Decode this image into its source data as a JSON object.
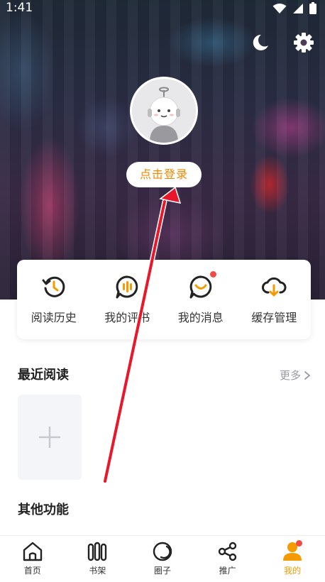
{
  "status_bar": {
    "time": "1:41"
  },
  "header": {
    "icons": [
      "moon-icon",
      "gear-icon"
    ]
  },
  "profile": {
    "login_label": "点击登录"
  },
  "quick_actions": [
    {
      "label": "阅读历史",
      "icon": "history-icon"
    },
    {
      "label": "我的评书",
      "icon": "review-icon"
    },
    {
      "label": "我的消息",
      "icon": "message-icon"
    },
    {
      "label": "缓存管理",
      "icon": "cloud-download-icon"
    }
  ],
  "recent": {
    "title": "最近阅读",
    "more_label": "更多"
  },
  "other": {
    "title": "其他功能"
  },
  "tabs": [
    {
      "label": "首页",
      "icon": "home-icon"
    },
    {
      "label": "书架",
      "icon": "bookshelf-icon"
    },
    {
      "label": "圈子",
      "icon": "circle-icon"
    },
    {
      "label": "推广",
      "icon": "share-icon"
    },
    {
      "label": "我的",
      "icon": "profile-icon",
      "active": true
    }
  ],
  "colors": {
    "accent": "#f59a00",
    "badge": "#f24a44",
    "annotation_arrow": "#e8182a"
  }
}
